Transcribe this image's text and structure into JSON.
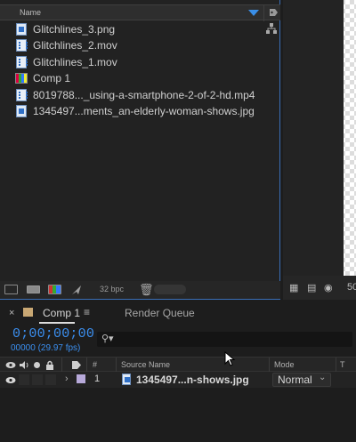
{
  "project": {
    "column_name": "Name",
    "files": [
      {
        "label": "Glitchlines_3.png",
        "icon": "image-file-icon"
      },
      {
        "label": "Glitchlines_2.mov",
        "icon": "video-file-icon"
      },
      {
        "label": "Glitchlines_1.mov",
        "icon": "video-file-icon"
      },
      {
        "label": "Comp 1",
        "icon": "composition-icon"
      },
      {
        "label": "8019788..._using-a-smartphone-2-of-2-hd.mp4",
        "icon": "video-file-icon"
      },
      {
        "label": "1345497...ments_an-elderly-woman-shows.jpg",
        "icon": "image-file-icon"
      }
    ],
    "bpc": "32 bpc"
  },
  "viewer": {
    "zoom": "50"
  },
  "timeline": {
    "tab_comp": "Comp 1",
    "tab_render": "Render Queue",
    "timecode": "0;00;00;00",
    "frames": "00000 (29.97 fps)",
    "columns": {
      "hash": "#",
      "source_name": "Source Name",
      "mode": "Mode",
      "t": "T"
    },
    "layer": {
      "number": "1",
      "name": "1345497...n-shows.jpg",
      "mode": "Normal"
    }
  },
  "colors": {
    "accent": "#3b8ff0",
    "panel_border": "#3a6fb8",
    "layer_label": "#b7a9d9",
    "comp_label": "#c9a874"
  }
}
